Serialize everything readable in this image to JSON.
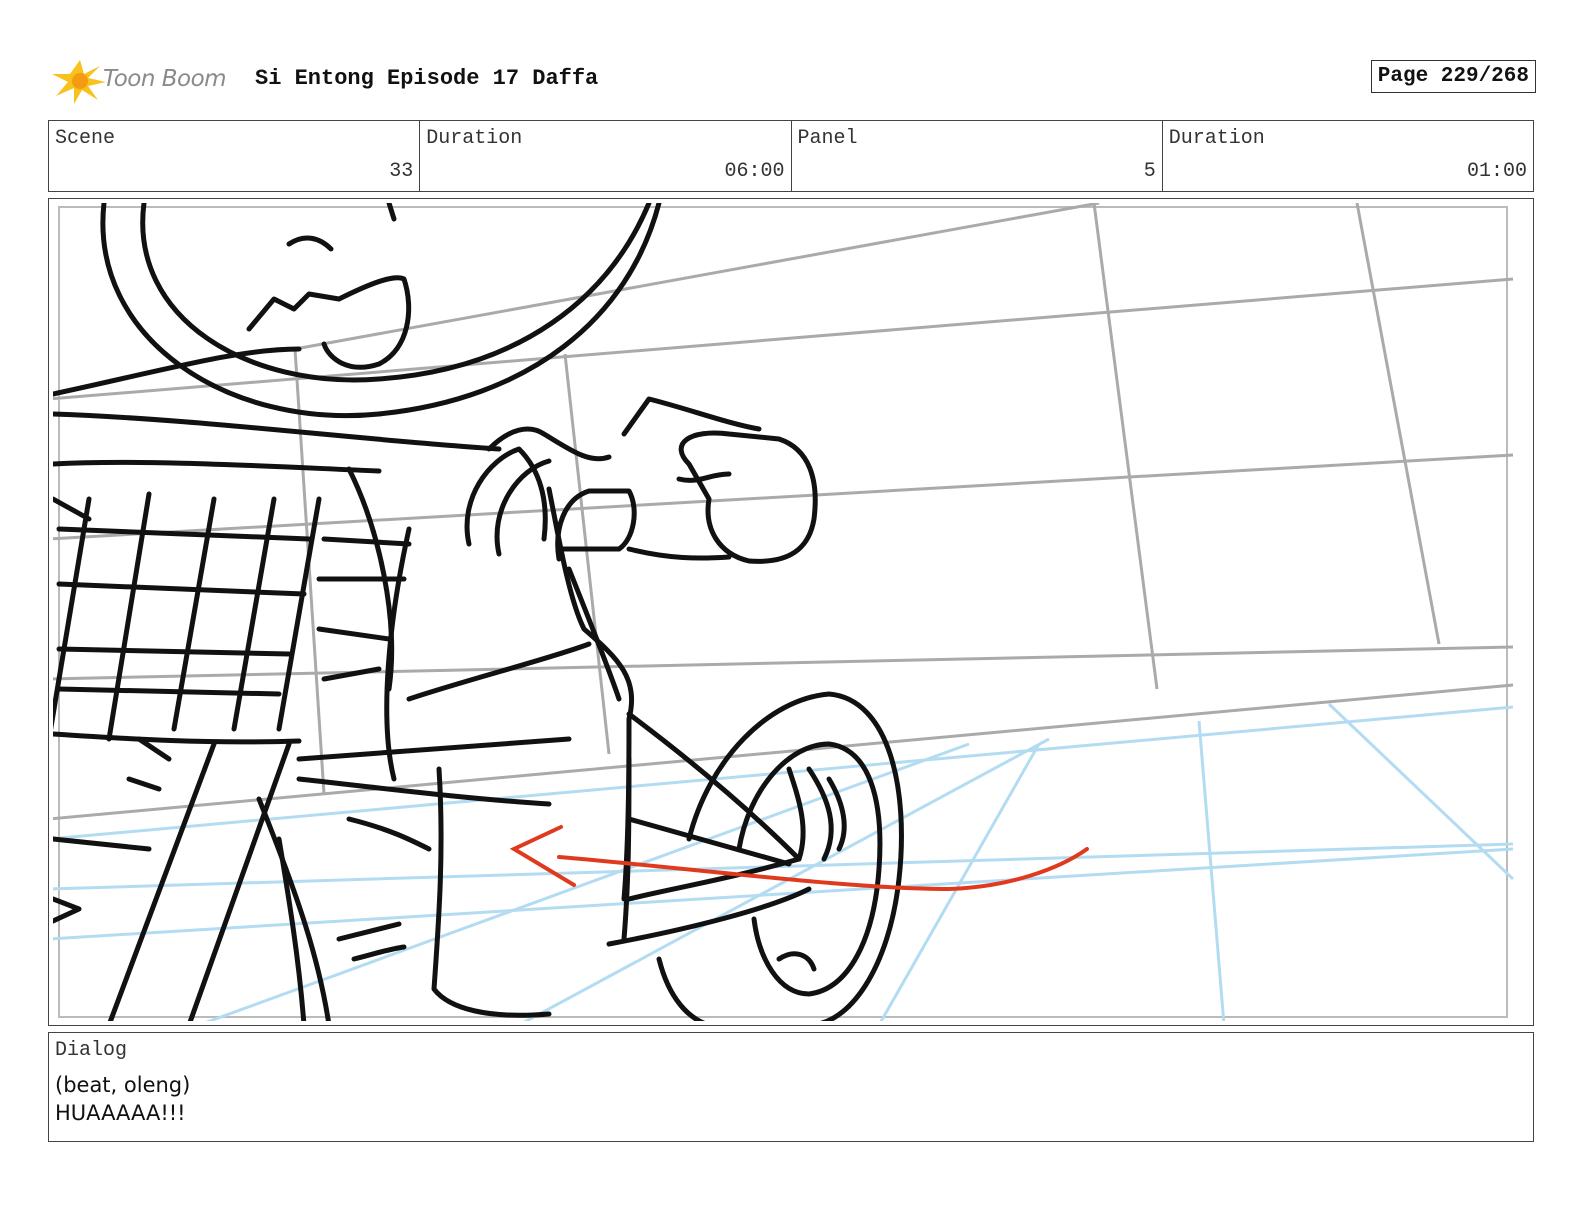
{
  "header": {
    "logo_text": "Toon Boom",
    "title": "Si Entong Episode 17 Daffa",
    "page": "Page 229/268"
  },
  "info": {
    "scene_label": "Scene",
    "scene_value": "33",
    "duration_label": "Duration",
    "duration_value": "06:00",
    "panel_label": "Panel",
    "panel_value": "5",
    "panel_duration_label": "Duration",
    "panel_duration_value": "01:00"
  },
  "dialog": {
    "label": "Dialog",
    "lines": [
      "(beat, oleng)",
      "HUAAAAA!!!"
    ]
  },
  "colors": {
    "sketch": "#111111",
    "grid_gray": "#aaaaaa",
    "grid_blue": "#b3dcf2",
    "arrow_red": "#e03a1e",
    "logo_yellow": "#f7c21b"
  }
}
